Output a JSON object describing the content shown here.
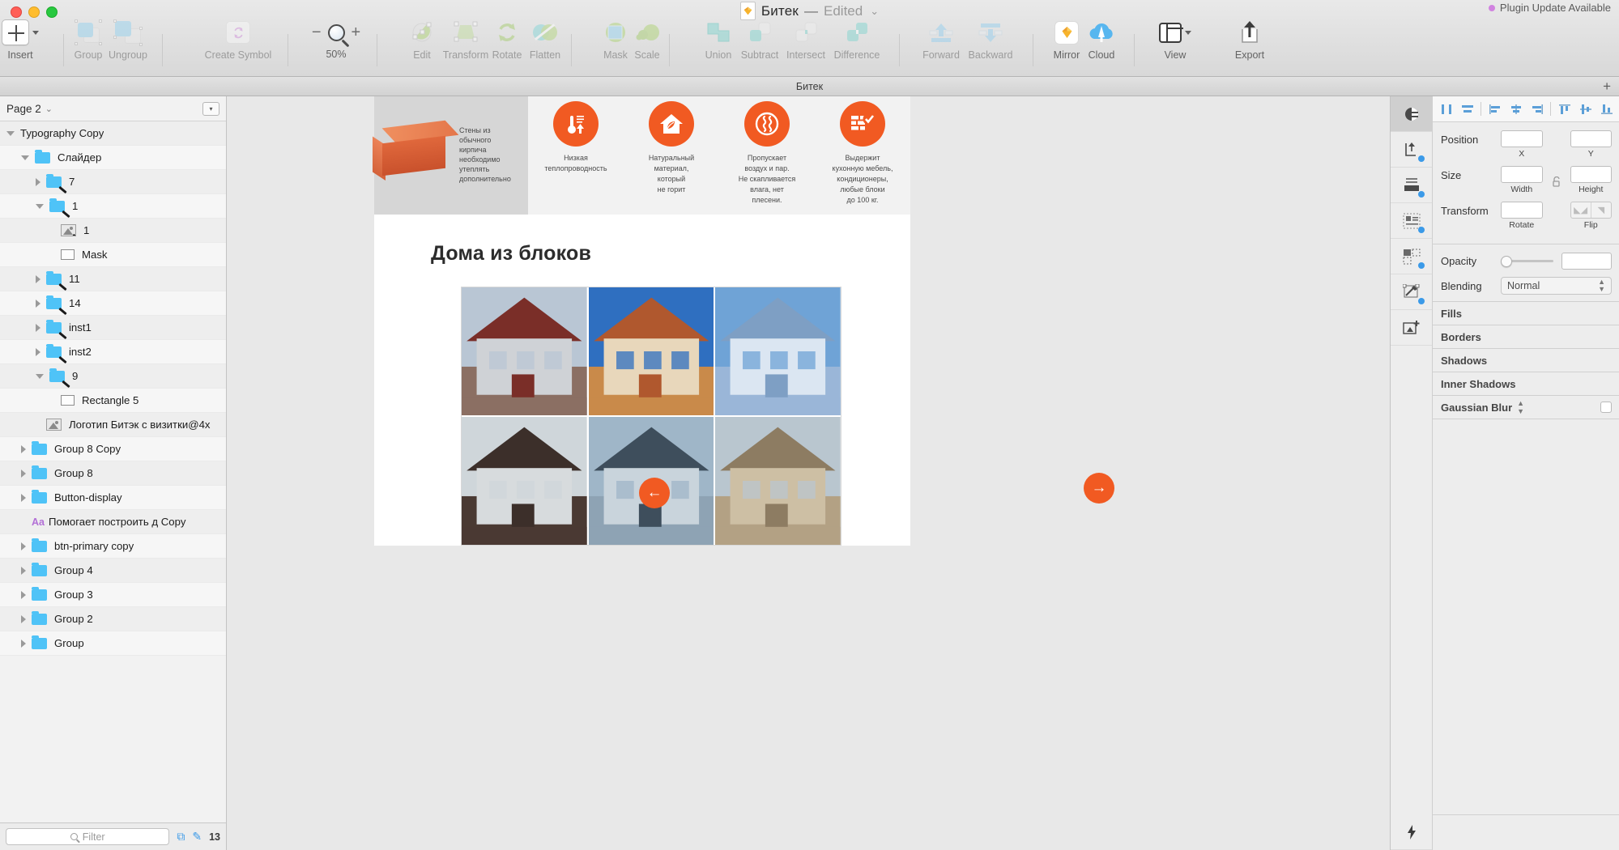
{
  "window": {
    "title": "Битек",
    "state": "Edited",
    "plugin_notice": "Plugin Update Available",
    "tab_name": "Битек"
  },
  "toolbar": {
    "items": [
      {
        "label": "Insert",
        "icon": "plus-box-icon",
        "dim": false
      },
      {
        "label": "Group",
        "icon": "group-icon",
        "dim": true
      },
      {
        "label": "Ungroup",
        "icon": "ungroup-icon",
        "dim": true
      },
      {
        "label": "Create Symbol",
        "icon": "create-symbol-icon",
        "dim": true
      },
      {
        "label": "Edit",
        "icon": "edit-icon",
        "dim": true
      },
      {
        "label": "Transform",
        "icon": "transform-icon",
        "dim": true
      },
      {
        "label": "Rotate",
        "icon": "rotate-icon",
        "dim": true
      },
      {
        "label": "Flatten",
        "icon": "flatten-icon",
        "dim": true
      },
      {
        "label": "Mask",
        "icon": "mask-icon",
        "dim": true
      },
      {
        "label": "Scale",
        "icon": "scale-icon",
        "dim": true
      },
      {
        "label": "Union",
        "icon": "union-icon",
        "dim": true
      },
      {
        "label": "Subtract",
        "icon": "subtract-icon",
        "dim": true
      },
      {
        "label": "Intersect",
        "icon": "intersect-icon",
        "dim": true
      },
      {
        "label": "Difference",
        "icon": "difference-icon",
        "dim": true
      },
      {
        "label": "Forward",
        "icon": "forward-icon",
        "dim": true
      },
      {
        "label": "Backward",
        "icon": "backward-icon",
        "dim": true
      },
      {
        "label": "Mirror",
        "icon": "mirror-icon",
        "dim": false
      },
      {
        "label": "Cloud",
        "icon": "cloud-upload-icon",
        "dim": false
      },
      {
        "label": "View",
        "icon": "view-icon",
        "dim": false
      },
      {
        "label": "Export",
        "icon": "export-icon",
        "dim": false
      }
    ],
    "zoom_level": "50%",
    "zoom_out": "−",
    "zoom_in": "+"
  },
  "sidebar": {
    "page_name": "Page 2",
    "layers": [
      {
        "label": "Typography Copy",
        "depth": 0,
        "type": "artboard",
        "expanded": true
      },
      {
        "label": "Слайдер",
        "depth": 1,
        "type": "folder",
        "expanded": true
      },
      {
        "label": "7",
        "depth": 2,
        "type": "folder-edit",
        "expanded": false
      },
      {
        "label": "1",
        "depth": 2,
        "type": "folder-edit",
        "expanded": true
      },
      {
        "label": "1",
        "depth": 3,
        "type": "image-mask",
        "expanded": null
      },
      {
        "label": "Mask",
        "depth": 3,
        "type": "rect",
        "expanded": null
      },
      {
        "label": "11",
        "depth": 2,
        "type": "folder-edit",
        "expanded": false
      },
      {
        "label": "14",
        "depth": 2,
        "type": "folder-edit",
        "expanded": false
      },
      {
        "label": "inst1",
        "depth": 2,
        "type": "folder-edit",
        "expanded": false
      },
      {
        "label": "inst2",
        "depth": 2,
        "type": "folder-edit",
        "expanded": false
      },
      {
        "label": "9",
        "depth": 2,
        "type": "folder-edit",
        "expanded": true
      },
      {
        "label": "Rectangle 5",
        "depth": 3,
        "type": "rect",
        "expanded": null
      },
      {
        "label": "Логотип Битэк с визитки@4x",
        "depth": 2,
        "type": "image",
        "expanded": null
      },
      {
        "label": "Group 8 Copy",
        "depth": 1,
        "type": "folder",
        "expanded": false
      },
      {
        "label": "Group 8",
        "depth": 1,
        "type": "folder",
        "expanded": false
      },
      {
        "label": "Button-display",
        "depth": 1,
        "type": "folder",
        "expanded": false
      },
      {
        "label": "Помогает построить д Copy",
        "depth": 1,
        "type": "text",
        "expanded": null
      },
      {
        "label": "btn-primary copy",
        "depth": 1,
        "type": "folder",
        "expanded": false
      },
      {
        "label": "Group 4",
        "depth": 1,
        "type": "folder",
        "expanded": false
      },
      {
        "label": "Group 3",
        "depth": 1,
        "type": "folder",
        "expanded": false
      },
      {
        "label": "Group 2",
        "depth": 1,
        "type": "folder",
        "expanded": false
      },
      {
        "label": "Group",
        "depth": 1,
        "type": "folder",
        "expanded": false
      }
    ],
    "filter_placeholder": "Filter",
    "layer_count": "13"
  },
  "inspector": {
    "position_label": "Position",
    "x_label": "X",
    "y_label": "Y",
    "size_label": "Size",
    "width_label": "Width",
    "height_label": "Height",
    "transform_label": "Transform",
    "rotate_label": "Rotate",
    "flip_label": "Flip",
    "opacity_label": "Opacity",
    "blending_label": "Blending",
    "blending_value": "Normal",
    "sections": [
      "Fills",
      "Borders",
      "Shadows",
      "Inner Shadows"
    ],
    "blur_label": "Gaussian Blur",
    "position_x": "",
    "position_y": "",
    "size_w": "",
    "size_h": "",
    "rotate_value": "",
    "opacity_value": ""
  },
  "canvas": {
    "brick_caption": "Стены из обычного кирпича необходимо утеплять дополнительно",
    "features": [
      {
        "icon": "thermometer-icon",
        "text": "Низкая\nтеплопроводность"
      },
      {
        "icon": "house-leaf-icon",
        "text": "Натуральный\nматериал,\nкоторый\nне горит"
      },
      {
        "icon": "vapor-icon",
        "text": "Пропускает\nвоздух и пар.\nНе скапливается\nвлага, нет\nплесени."
      },
      {
        "icon": "brick-check-icon",
        "text": "Выдержит\nкухонную мебель,\nкондиционеры,\nлюбые блоки\nдо 100 кг."
      }
    ],
    "heading": "Дома из блоков",
    "accent_color": "#f15a22",
    "prev_arrow": "←",
    "next_arrow": "→",
    "gallery_cells": [
      {
        "name": "house-1",
        "c1": "#cfd2d6",
        "c2": "#8b6f63",
        "roof": "#7a2e28",
        "sky": "#b9c6d4"
      },
      {
        "name": "house-2",
        "c1": "#e8d7bb",
        "c2": "#c98a4a",
        "roof": "#b0582e",
        "sky": "#2f6fc0"
      },
      {
        "name": "house-3",
        "c1": "#dbe6f2",
        "c2": "#9ab6d8",
        "roof": "#7e9fc4",
        "sky": "#6fa3d6"
      },
      {
        "name": "house-4",
        "c1": "#d7dbdd",
        "c2": "#4a3a33",
        "roof": "#3c2f2a",
        "sky": "#cfd6da"
      },
      {
        "name": "house-5",
        "c1": "#c9d4dc",
        "c2": "#8ea3b4",
        "roof": "#3e4e5c",
        "sky": "#9fb6c8"
      },
      {
        "name": "house-6",
        "c1": "#cdbfa4",
        "c2": "#b3a184",
        "roof": "#8d7c62",
        "sky": "#b9c6cf"
      }
    ]
  }
}
